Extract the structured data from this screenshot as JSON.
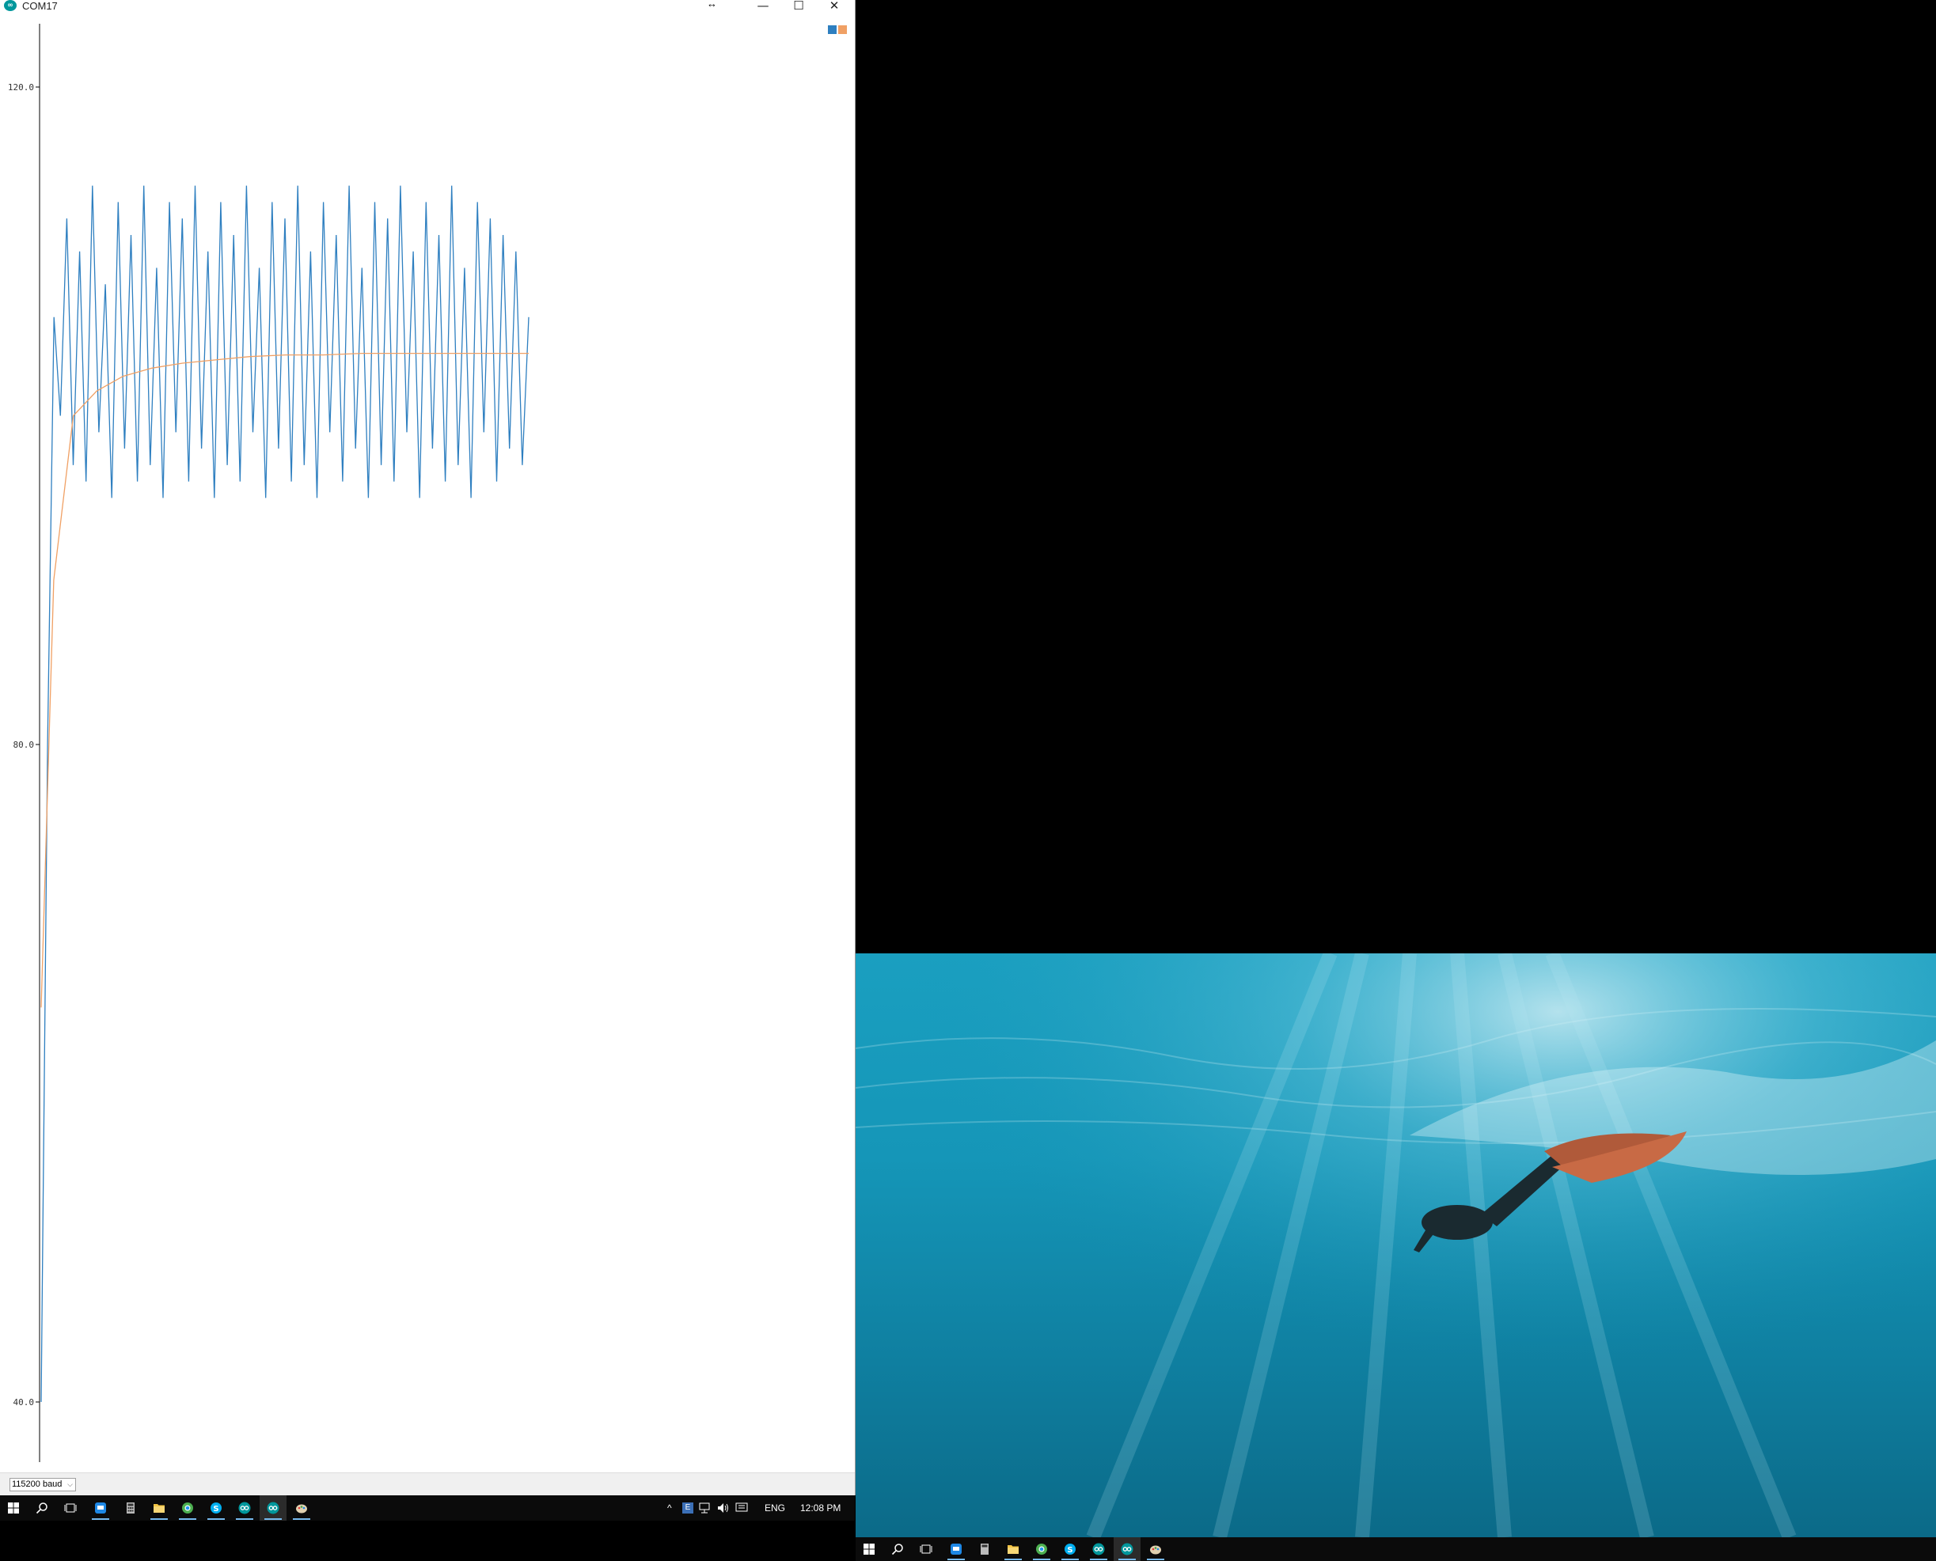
{
  "window": {
    "title": "COM17",
    "app_icon_glyph": "∞",
    "resize_cursor": "↔",
    "minimize_glyph": "—",
    "maximize_glyph": "☐",
    "close_glyph": "✕"
  },
  "legend": {
    "series_colors": [
      "#2e7fc0",
      "#f0a064"
    ]
  },
  "chart_data": {
    "type": "line",
    "ylim": [
      40,
      120
    ],
    "y_ticks": [
      "120.0",
      "80.0",
      "40.0"
    ],
    "title": "",
    "xlabel": "",
    "ylabel": "",
    "grid": false,
    "legend": "top-right",
    "series": [
      {
        "color": "#2e7fc0",
        "shape": "oscillating signal",
        "x_range": [
          0,
          400
        ],
        "min": 95.2,
        "max": 114.1,
        "values_sample": [
          40,
          80,
          106,
          100,
          112,
          97,
          110,
          96,
          114,
          99,
          108,
          95,
          113,
          98,
          111,
          96,
          114,
          97,
          109,
          95,
          113,
          99,
          112,
          96,
          114,
          98,
          110,
          95,
          113,
          97,
          111,
          96,
          114,
          99,
          109,
          95,
          113,
          98,
          112,
          96,
          114,
          97,
          110,
          95,
          113,
          99,
          111,
          96,
          114,
          98,
          109,
          95,
          113,
          97,
          112,
          96,
          114,
          99,
          110,
          95,
          113,
          98,
          111,
          96,
          114,
          97,
          109,
          95,
          113,
          99,
          112,
          96,
          111,
          98,
          110,
          97,
          106
        ]
      },
      {
        "color": "#f0a064",
        "shape": "smoothed average",
        "values_sample": [
          64,
          90,
          100,
          101.5,
          102.4,
          102.9,
          103.2,
          103.4,
          103.6,
          103.7,
          103.7,
          103.8,
          103.8,
          103.8,
          103.8,
          103.8
        ]
      }
    ]
  },
  "statusbar": {
    "baud": "115200 baud",
    "arrow": "⌵"
  },
  "taskbar": {
    "tray_chevron": "^",
    "language": "ENG",
    "time": "12:08 PM"
  }
}
